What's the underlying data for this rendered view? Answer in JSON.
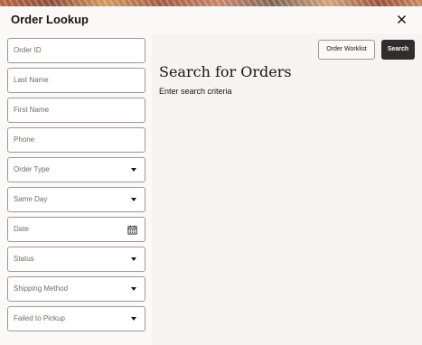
{
  "dialog": {
    "title": "Order Lookup",
    "close_icon": "close-icon"
  },
  "form": {
    "order_id_placeholder": "Order ID",
    "last_name_placeholder": "Last Name",
    "first_name_placeholder": "First Name",
    "phone_placeholder": "Phone",
    "order_type_placeholder": "Order Type",
    "same_day_placeholder": "Same Day",
    "date_placeholder": "Date",
    "status_placeholder": "Status",
    "shipping_method_placeholder": "Shipping Method",
    "failed_to_pickup_placeholder": "Failed to Pickup"
  },
  "actions": {
    "order_worklist_label": "Order Worklist",
    "search_label": "Search"
  },
  "results": {
    "heading": "Search for Orders",
    "subtext": "Enter search criteria"
  },
  "icons": {
    "dropdown": "chevron-down-icon",
    "calendar": "calendar-icon"
  },
  "colors": {
    "primary_button": "#312d2a",
    "panel_background": "#f5f4f2",
    "field_border": "#9e9893"
  }
}
